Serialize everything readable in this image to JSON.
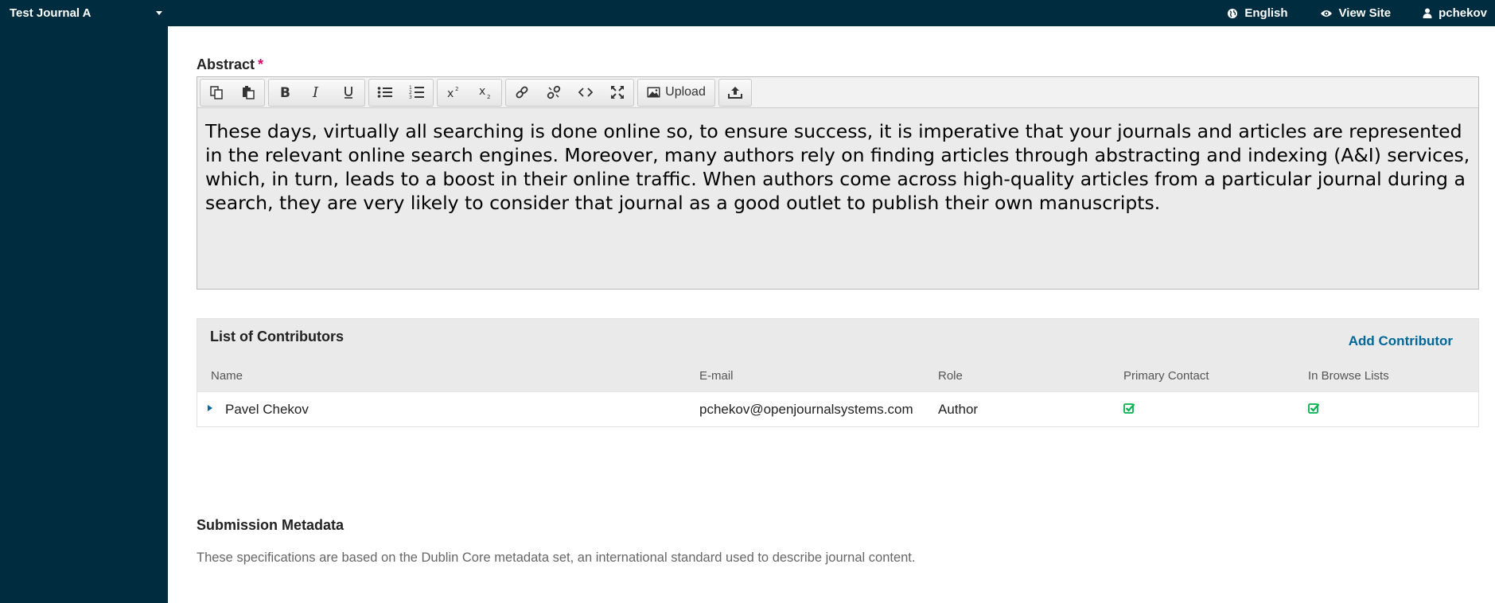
{
  "topbar": {
    "journal_name": "Test Journal A",
    "language_label": "English",
    "view_site_label": "View Site",
    "user_label": "pchekov"
  },
  "abstract": {
    "label": "Abstract",
    "required_mark": "*",
    "upload_label": "Upload",
    "text": "These days, virtually all searching is done online so, to ensure success, it is imperative that your journals and articles are represented in the relevant online search engines. Moreover, many authors rely on finding articles through abstracting and indexing (A&I) services, which, in turn, leads to a boost in their online traffic. When authors come across high-quality articles from a particular journal during a search, they are very likely to consider that journal as a good outlet to publish their own manuscripts."
  },
  "contributors": {
    "title": "List of Contributors",
    "add_label": "Add Contributor",
    "columns": [
      "Name",
      "E-mail",
      "Role",
      "Primary Contact",
      "In Browse Lists"
    ],
    "rows": [
      {
        "name": "Pavel Chekov",
        "email": "pchekov@openjournalsystems.com",
        "role": "Author",
        "primary_contact": true,
        "in_browse_lists": true
      }
    ]
  },
  "metadata": {
    "title": "Submission Metadata",
    "description": "These specifications are based on the Dublin Core metadata set, an international standard used to describe journal content."
  },
  "colors": {
    "nav_bg": "#002c40",
    "link": "#006798",
    "check": "#00b24e",
    "required": "#d00a6c"
  }
}
